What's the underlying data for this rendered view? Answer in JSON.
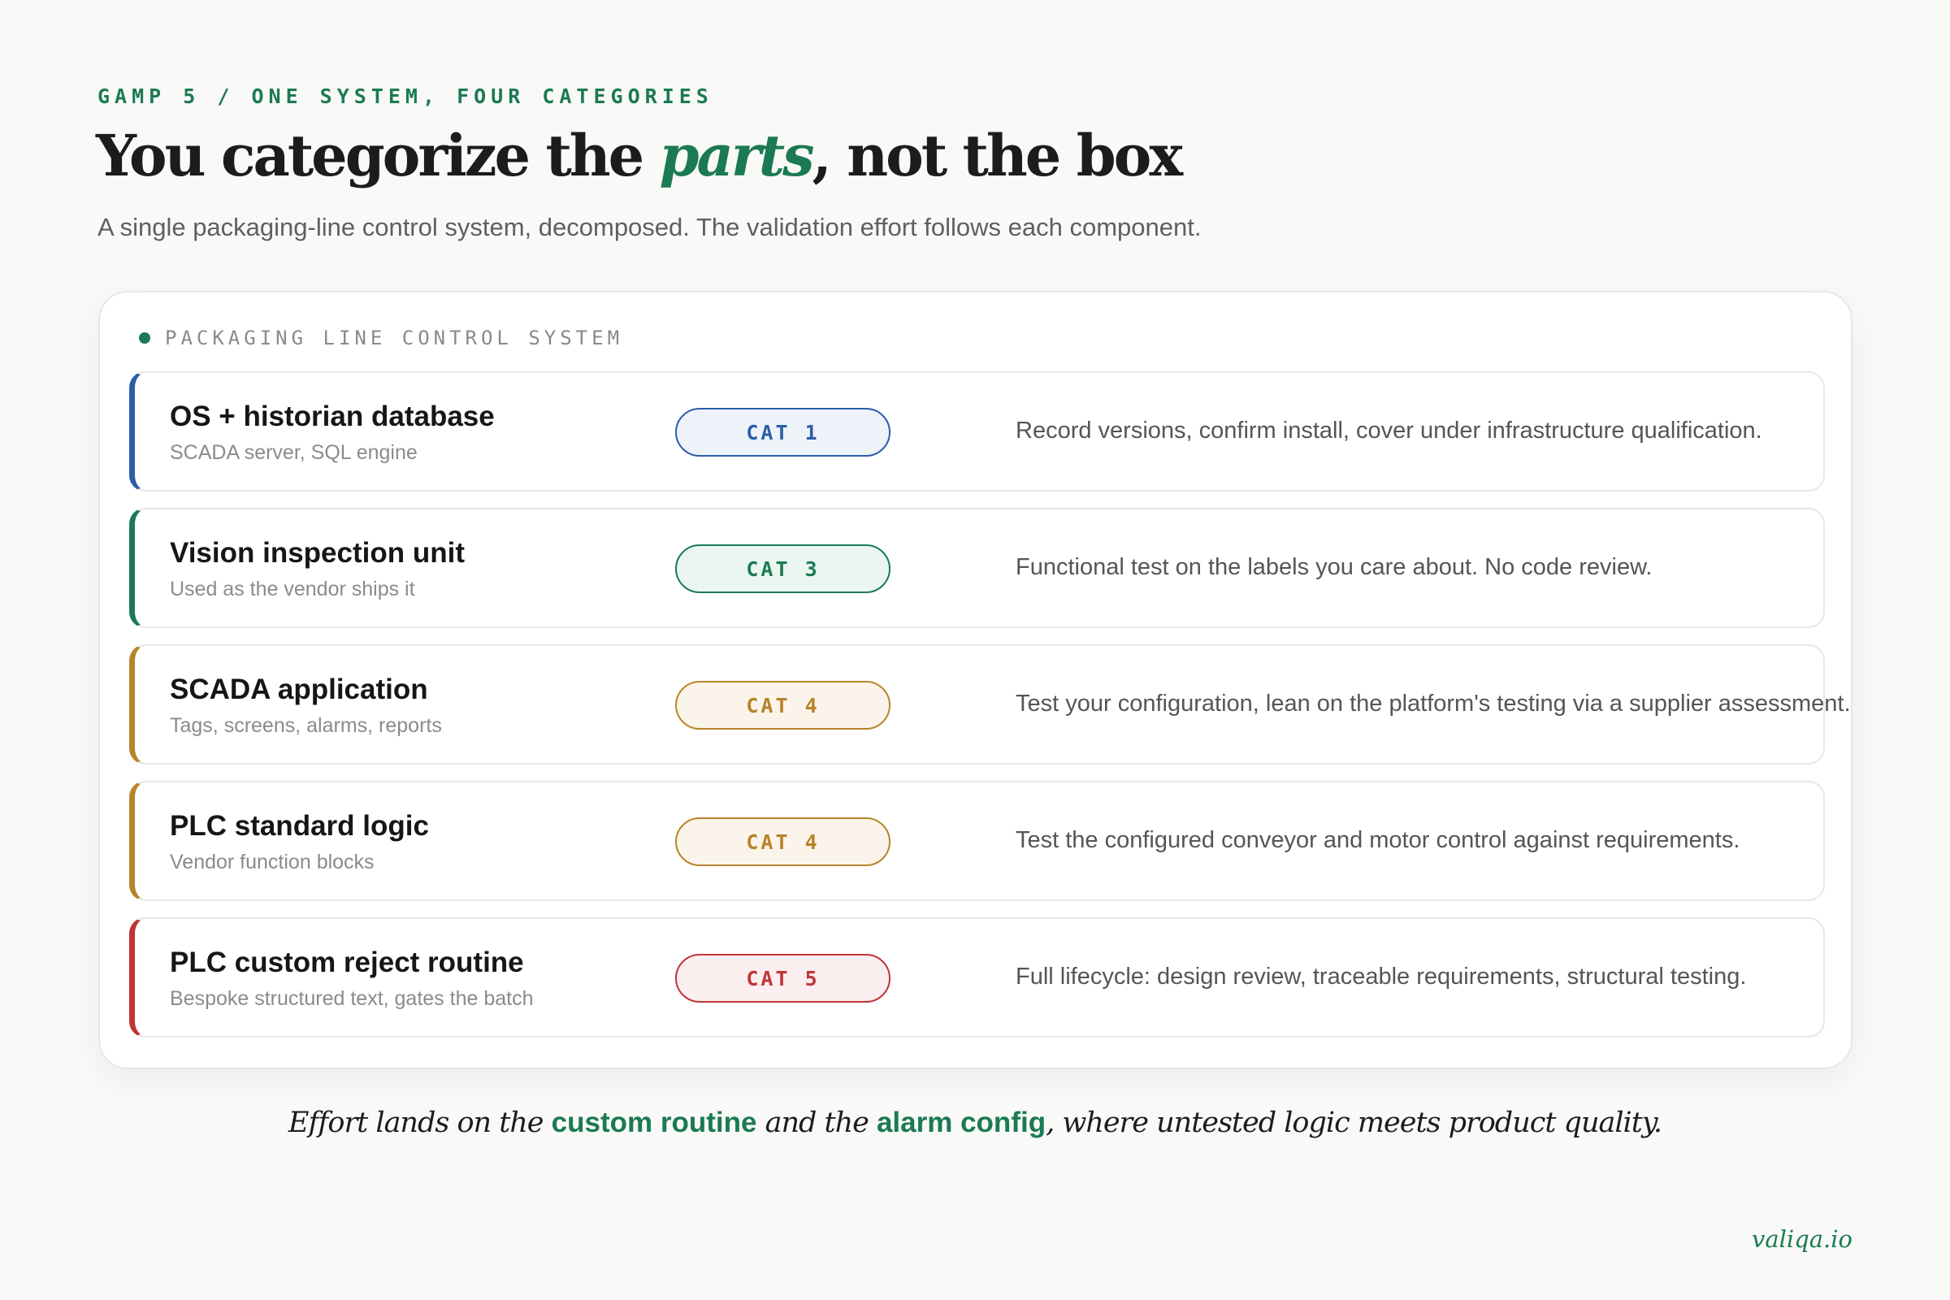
{
  "eyebrow": "GAMP 5 / ONE SYSTEM, FOUR CATEGORIES",
  "title": {
    "before": "You categorize the ",
    "accent": "parts",
    "after": ", not the box"
  },
  "subtitle": "A single packaging-line control system, decomposed. The validation effort follows each component.",
  "panel": {
    "label": "PACKAGING LINE CONTROL SYSTEM"
  },
  "colors": {
    "accent": "#1b7a55",
    "cat1": "#2b5ea7",
    "cat3": "#1b7a55",
    "cat4": "#b7842a",
    "cat5": "#c0343a"
  },
  "components": [
    {
      "title": "OS + historian database",
      "subtitle": "SCADA server, SQL engine",
      "badge": "CAT 1",
      "description": "Record versions, confirm install, cover under infrastructure qualification.",
      "color": "#2b5ea7",
      "badge_bg": "#eef3fa"
    },
    {
      "title": "Vision inspection unit",
      "subtitle": "Used as the vendor ships it",
      "badge": "CAT 3",
      "description": "Functional test on the labels you care about. No code review.",
      "color": "#1b7a55",
      "badge_bg": "#ecf6f1"
    },
    {
      "title": "SCADA application",
      "subtitle": "Tags, screens, alarms, reports",
      "badge": "CAT 4",
      "description": "Test your configuration, lean on the platform's testing via a supplier assessment.",
      "color": "#b7842a",
      "badge_bg": "#fbf4ea"
    },
    {
      "title": "PLC standard logic",
      "subtitle": "Vendor function blocks",
      "badge": "CAT 4",
      "description": "Test the configured conveyor and motor control against requirements.",
      "color": "#b7842a",
      "badge_bg": "#fbf4ea"
    },
    {
      "title": "PLC custom reject routine",
      "subtitle": "Bespoke structured text, gates the batch",
      "badge": "CAT 5",
      "description": "Full lifecycle: design review, traceable requirements, structural testing.",
      "color": "#c0343a",
      "badge_bg": "#fbeeee"
    }
  ],
  "footnote": {
    "part1": "Effort lands on the ",
    "highlight1": "custom routine",
    "part2": " and the ",
    "highlight2": "alarm config",
    "part3": ", where untested logic meets product quality."
  },
  "brand": "valiqa.io"
}
